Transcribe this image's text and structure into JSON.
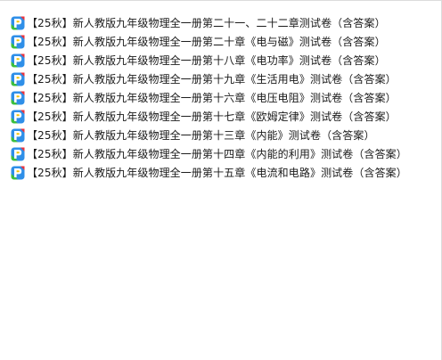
{
  "file_list": {
    "icon": "pdf-document-icon",
    "icon_colors": [
      "#2f8fe8",
      "#f2c200",
      "#3cc03c",
      "#e8323c"
    ],
    "items": [
      {
        "name": "【25秋】新人教版九年级物理全一册第二十一、二十二章测试卷（含答案）"
      },
      {
        "name": "【25秋】新人教版九年级物理全一册第二十章《电与磁》测试卷（含答案）"
      },
      {
        "name": "【25秋】新人教版九年级物理全一册第十八章《电功率》测试卷（含答案）"
      },
      {
        "name": "【25秋】新人教版九年级物理全一册第十九章《生活用电》测试卷（含答案）"
      },
      {
        "name": "【25秋】新人教版九年级物理全一册第十六章《电压电阻》测试卷（含答案）"
      },
      {
        "name": "【25秋】新人教版九年级物理全一册第十七章《欧姆定律》测试卷（含答案）"
      },
      {
        "name": "【25秋】新人教版九年级物理全一册第十三章《内能》测试卷（含答案）"
      },
      {
        "name": "【25秋】新人教版九年级物理全一册第十四章《内能的利用》测试卷（含答案）"
      },
      {
        "name": "【25秋】新人教版九年级物理全一册第十五章《电流和电路》测试卷（含答案）"
      }
    ]
  }
}
